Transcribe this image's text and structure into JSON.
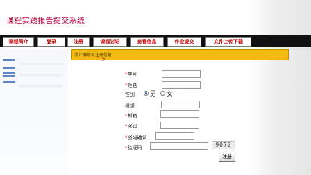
{
  "header": {
    "title": "课程实践报告提交系统"
  },
  "nav": {
    "items": [
      {
        "label": "课程简介"
      },
      {
        "label": "登录"
      },
      {
        "label": "注册"
      },
      {
        "label": "课程讨论"
      },
      {
        "label": "查看信息"
      },
      {
        "label": "作业提交"
      },
      {
        "label": "文件上传下载"
      }
    ]
  },
  "banner": {
    "text": "请正确填写注册信息"
  },
  "form": {
    "fields": [
      {
        "label": "学号",
        "required": true,
        "value": ""
      },
      {
        "label": "姓名",
        "required": true,
        "value": ""
      },
      {
        "label": "性别",
        "required": false
      },
      {
        "label": "班级",
        "required": false,
        "value": ""
      },
      {
        "label": "邮箱",
        "required": true,
        "value": ""
      },
      {
        "label": "密码",
        "required": true,
        "value": ""
      },
      {
        "label": "密码确认",
        "required": true,
        "value": ""
      },
      {
        "label": "验证码",
        "required": true,
        "value": ""
      }
    ],
    "gender": {
      "male": "男",
      "female": "女",
      "selected": "男"
    },
    "captcha": "9072",
    "submit_label": "注册"
  },
  "colors": {
    "title": "#c0003c",
    "nav_bar": "#111111",
    "nav_text": "#c00000",
    "banner": "#f2bb10",
    "required_star": "#cc0000"
  }
}
